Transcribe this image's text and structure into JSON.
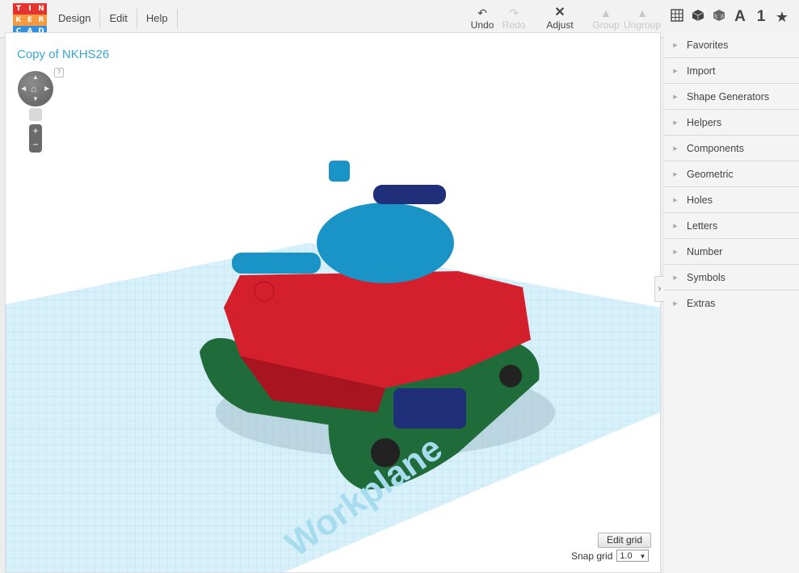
{
  "logo": {
    "letters": [
      "T",
      "I",
      "N",
      "K",
      "E",
      "R",
      "C",
      "A",
      "D"
    ],
    "colors": [
      "#e3342f",
      "#e3342f",
      "#e3342f",
      "#f6993f",
      "#f6993f",
      "#f6993f",
      "#3490dc",
      "#3490dc",
      "#3490dc"
    ]
  },
  "menu": {
    "design": "Design",
    "edit": "Edit",
    "help": "Help"
  },
  "toolbar": {
    "undo": "Undo",
    "redo": "Redo",
    "adjust": "Adjust",
    "group": "Group",
    "ungroup": "Ungroup"
  },
  "view": {
    "text_icon": "A",
    "number_icon": "1"
  },
  "project": {
    "title": "Copy of NKHS26"
  },
  "workplane": {
    "label": "Workplane"
  },
  "panel": {
    "items": [
      "Favorites",
      "Import",
      "Shape Generators",
      "Helpers",
      "Components",
      "Geometric",
      "Holes",
      "Letters",
      "Number",
      "Symbols",
      "Extras"
    ]
  },
  "grid": {
    "edit_label": "Edit grid",
    "snap_label": "Snap grid",
    "snap_value": "1.0"
  },
  "nav": {
    "help": "?",
    "zoom_in": "+",
    "zoom_out": "−"
  },
  "colors": {
    "accent": "#3aa6d5",
    "tank_body": "#d41f2c",
    "tank_turret": "#1a93c7",
    "tank_tracks": "#1f6b3a",
    "wheels": "#1f2f7a",
    "grid": "#82cbe8"
  }
}
